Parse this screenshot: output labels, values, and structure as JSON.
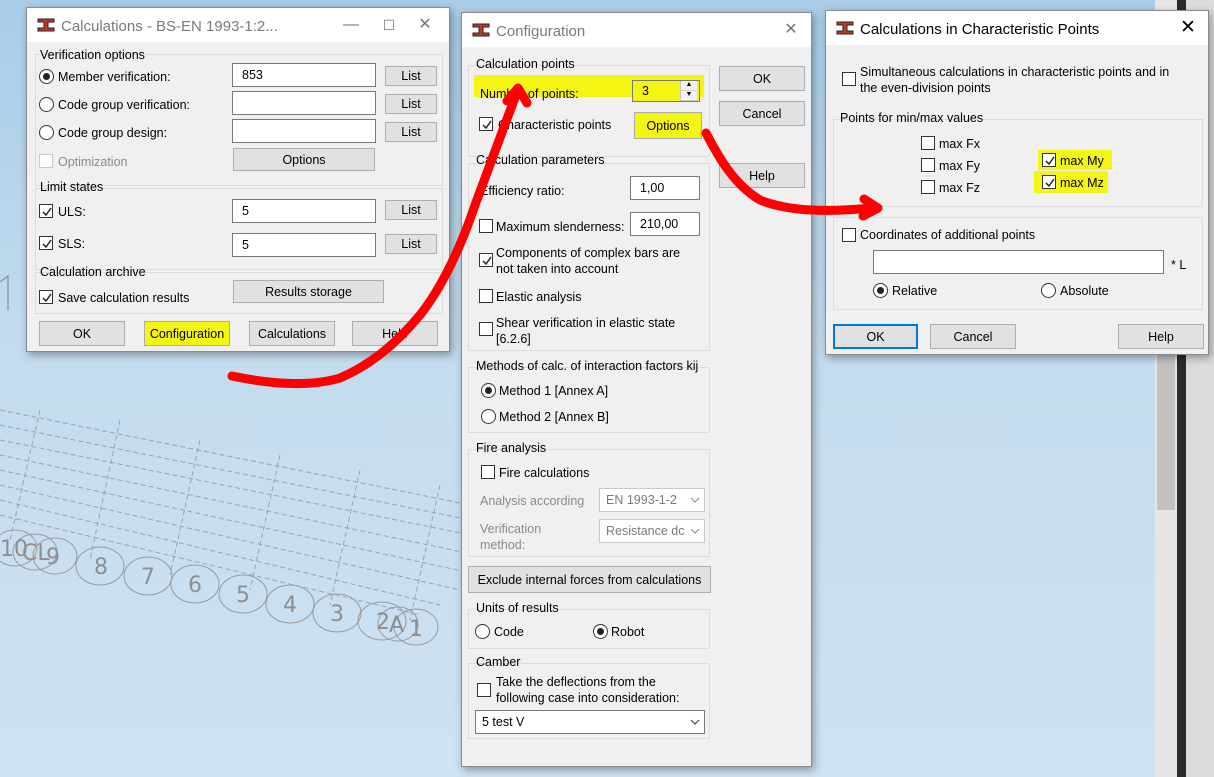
{
  "background": {
    "axis_labels": [
      "10",
      "CL",
      "9",
      "8",
      "7",
      "6",
      "5",
      "4",
      "3",
      "2",
      "A",
      "1"
    ]
  },
  "calc_window": {
    "title": "Calculations - BS-EN 1993-1:2...",
    "verification_group": "Verification options",
    "member_verification": "Member verification:",
    "member_value": "853",
    "code_group_verification": "Code group verification:",
    "code_group_verification_value": "",
    "code_group_design": "Code group design:",
    "code_group_design_value": "",
    "list_label": "List",
    "optimization": "Optimization",
    "options_button": "Options",
    "limit_states_group": "Limit states",
    "uls_label": "ULS:",
    "uls_value": "5",
    "sls_label": "SLS:",
    "sls_value": "5",
    "archive_group": "Calculation archive",
    "save_results": "Save calculation results",
    "results_storage": "Results storage",
    "ok": "OK",
    "configuration": "Configuration",
    "calculations": "Calculations",
    "help": "Help"
  },
  "config_window": {
    "title": "Configuration",
    "calc_points_group": "Calculation points",
    "number_of_points_label": "Number of points:",
    "number_of_points_value": "3",
    "characteristic_points": "Characteristic points",
    "options_button": "Options",
    "ok": "OK",
    "cancel": "Cancel",
    "help": "Help",
    "calc_params_group": "Calculation parameters",
    "efficiency_ratio": "Efficiency ratio:",
    "efficiency_value": "1,00",
    "max_slenderness": "Maximum slenderness:",
    "max_slenderness_value": "210,00",
    "complex_bars_line1": "Components of complex bars are",
    "complex_bars_line2": "not taken into account",
    "elastic_analysis": "Elastic analysis",
    "shear_line1": "Shear verification in elastic state",
    "shear_line2": "[6.2.6]",
    "methods_group": "Methods of calc. of interaction factors kij",
    "method1": "Method 1 [Annex A]",
    "method2": "Method 2 [Annex B]",
    "fire_group": "Fire analysis",
    "fire_calculations": "Fire calculations",
    "analysis_according": "Analysis according",
    "analysis_value": "EN 1993-1-2",
    "verification_method_1": "Verification",
    "verification_method_2": "method:",
    "verification_value": "Resistance dc",
    "exclude_forces": "Exclude internal forces from calculations",
    "units_group": "Units of results",
    "units_code": "Code",
    "units_robot": "Robot",
    "camber_group": "Camber",
    "camber_line1": "Take the deflections from the",
    "camber_line2": "following case into consideration:",
    "camber_case": "5  test V"
  },
  "charpoints_window": {
    "title": "Calculations in Characteristic Points",
    "simultaneous_line1": "Simultaneous calculations in characteristic points and in",
    "simultaneous_line2": "the even-division points",
    "minmax_group": "Points for min/max values",
    "max_fx": "max Fx",
    "max_fy": "max Fy",
    "max_fz": "max Fz",
    "max_my": "max My",
    "max_mz": "max Mz",
    "coords_label": "Coordinates of additional points",
    "coords_value": "",
    "unit_suffix": "* L",
    "relative": "Relative",
    "absolute": "Absolute",
    "ok": "OK",
    "cancel": "Cancel",
    "help": "Help"
  },
  "colors": {
    "highlight": "#f5f514",
    "annotation_red": "#ff0000",
    "focus_blue": "#0078d7"
  }
}
